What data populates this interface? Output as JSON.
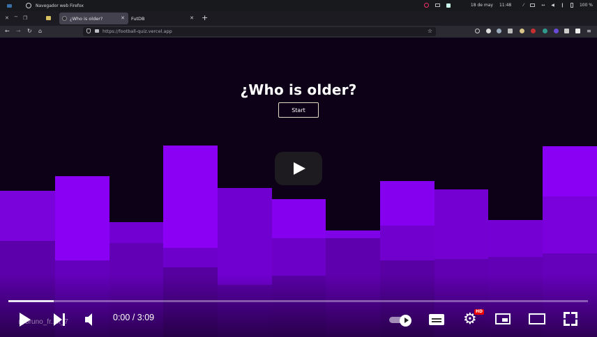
{
  "system_bar": {
    "app_title": "Navegador web Firefox",
    "date": "18 de may",
    "time": "11:48",
    "battery": "100 %"
  },
  "tabs": [
    {
      "title": "¿Who is older?",
      "active": true
    },
    {
      "title": "FutDB",
      "active": false
    }
  ],
  "new_tab_label": "+",
  "address_bar": {
    "url": "https://football-quiz.vercel.app"
  },
  "page": {
    "heading": "¿Who is older?",
    "start_label": "Start"
  },
  "player": {
    "current_time": "0:00",
    "duration": "3:09",
    "time_separator": "/",
    "progress_fraction": 0.078,
    "hd_badge": "HD",
    "watermark": "@bruno_fr..nt_7",
    "icons": [
      "play-icon",
      "next-icon",
      "volume-icon",
      "autoplay-toggle-icon",
      "subtitles-icon",
      "settings-icon",
      "miniplayer-icon",
      "theater-icon",
      "fullscreen-icon"
    ]
  },
  "colors": {
    "page_background": "#0d0117",
    "violet_light": "#8a00f5",
    "violet_mid": "#7400d0",
    "violet_dark": "#5a00a8",
    "button_border": "#e5dcc7",
    "hd_red": "#ee0000"
  }
}
